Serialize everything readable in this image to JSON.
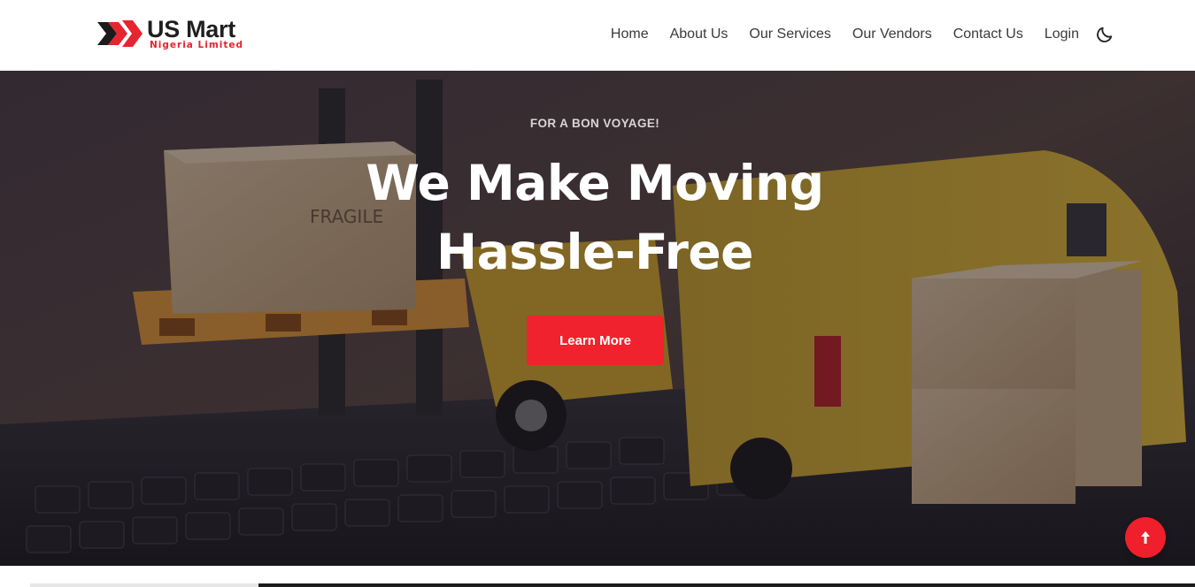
{
  "brand": {
    "name": "US Mart",
    "subtitle": "Nigeria Limited",
    "accent_color": "#e5252f"
  },
  "nav": {
    "items": [
      {
        "label": "Home"
      },
      {
        "label": "About Us"
      },
      {
        "label": "Our Services"
      },
      {
        "label": "Our Vendors"
      },
      {
        "label": "Contact Us"
      },
      {
        "label": "Login"
      }
    ],
    "theme_toggle_icon": "moon-icon"
  },
  "hero": {
    "kicker": "FOR A BON VOYAGE!",
    "title": "We Make Moving Hassle-Free",
    "button_label": "Learn More",
    "button_color": "#f0222d"
  },
  "scroll_top": {
    "icon": "arrow-up-icon",
    "color": "#ef1f2b"
  }
}
